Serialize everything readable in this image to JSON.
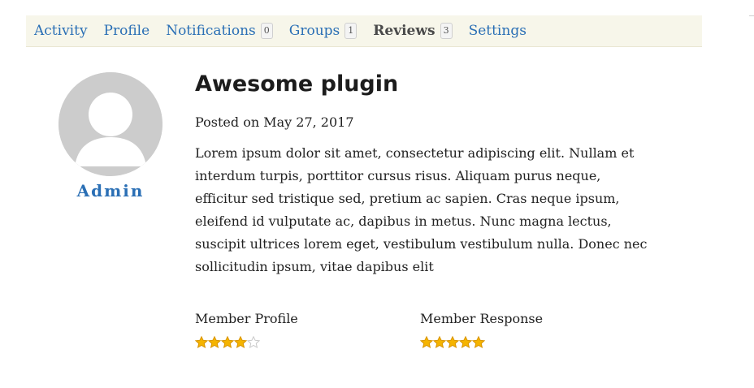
{
  "nav": {
    "tabs": [
      {
        "label": "Activity",
        "count": null,
        "active": false
      },
      {
        "label": "Profile",
        "count": null,
        "active": false
      },
      {
        "label": "Notifications",
        "count": "0",
        "active": false
      },
      {
        "label": "Groups",
        "count": "1",
        "active": false
      },
      {
        "label": "Reviews",
        "count": "3",
        "active": true
      },
      {
        "label": "Settings",
        "count": null,
        "active": false
      }
    ]
  },
  "review": {
    "author": "Admin",
    "title": "Awesome plugin",
    "posted": "Posted on May 27, 2017",
    "body": "Lorem ipsum dolor sit amet, consectetur adipiscing elit. Nullam et interdum turpis, porttitor cursus risus. Aliquam purus neque, efficitur sed tristique sed, pretium ac sapien. Cras neque ipsum, eleifend id vulputate ac, dapibus in metus. Nunc magna lectus, suscipit ultrices lorem eget, vestibulum vestibulum nulla. Donec nec sollicitudin ipsum, vitae dapibus elit"
  },
  "ratings": [
    {
      "label": "Member Profile",
      "value": 4,
      "max": 5
    },
    {
      "label": "Member Response",
      "value": 5,
      "max": 5
    }
  ],
  "colors": {
    "link": "#2a6fb5",
    "tabbar_bg": "#f7f6ea",
    "star_filled": "#f5b400",
    "star_empty": "#ffffff"
  }
}
